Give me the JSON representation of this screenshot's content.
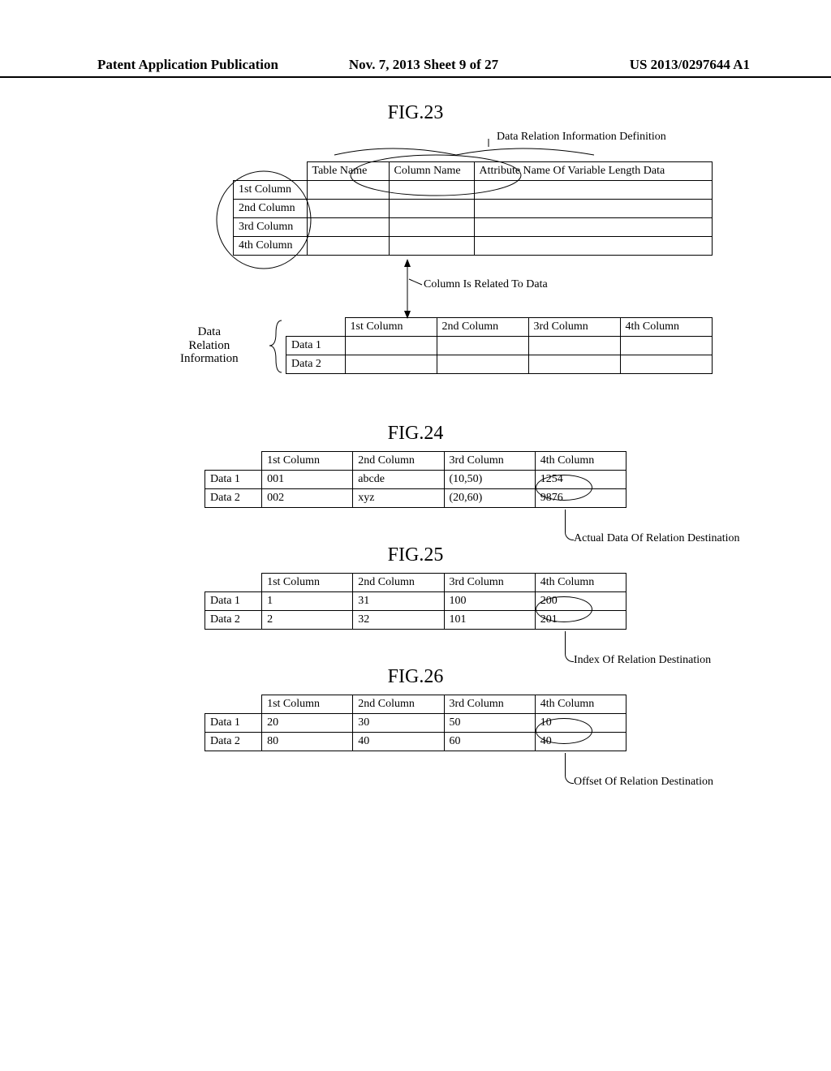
{
  "header": {
    "left": "Patent Application Publication",
    "mid": "Nov. 7, 2013  Sheet 9 of 27",
    "right": "US 2013/0297644 A1"
  },
  "fig23": {
    "label": "FIG.23",
    "def_label": "Data Relation Information Definition",
    "top_headers": {
      "th1": "Table Name",
      "th2": "Column Name",
      "th3": "Attribute Name Of Variable Length Data"
    },
    "rows": [
      "1st Column",
      "2nd Column",
      "3rd Column",
      "4th Column"
    ],
    "rel_msg": "Column Is Related To Data",
    "bot_headers": [
      "1st Column",
      "2nd Column",
      "3rd Column",
      "4th Column"
    ],
    "bot_rows": [
      "Data 1",
      "Data 2"
    ],
    "left_label_l1": "Data",
    "left_label_l2": "Relation",
    "left_label_l3": "Information"
  },
  "fig24": {
    "label": "FIG.24",
    "headers": [
      "1st Column",
      "2nd Column",
      "3rd Column",
      "4th Column"
    ],
    "rows": [
      {
        "name": "Data 1",
        "c1": "001",
        "c2": "abcde",
        "c3": "(10,50)",
        "c4": "1254"
      },
      {
        "name": "Data 2",
        "c1": "002",
        "c2": "xyz",
        "c3": "(20,60)",
        "c4": "9876"
      }
    ],
    "callout": "Actual Data Of Relation Destination"
  },
  "fig25": {
    "label": "FIG.25",
    "headers": [
      "1st Column",
      "2nd Column",
      "3rd Column",
      "4th Column"
    ],
    "rows": [
      {
        "name": "Data 1",
        "c1": "1",
        "c2": "31",
        "c3": "100",
        "c4": "200"
      },
      {
        "name": "Data 2",
        "c1": "2",
        "c2": "32",
        "c3": "101",
        "c4": "201"
      }
    ],
    "callout": "Index Of Relation Destination"
  },
  "fig26": {
    "label": "FIG.26",
    "headers": [
      "1st Column",
      "2nd Column",
      "3rd Column",
      "4th Column"
    ],
    "rows": [
      {
        "name": "Data 1",
        "c1": "20",
        "c2": "30",
        "c3": "50",
        "c4": "10"
      },
      {
        "name": "Data 2",
        "c1": "80",
        "c2": "40",
        "c3": "60",
        "c4": "40"
      }
    ],
    "callout": "Offset Of Relation Destination"
  }
}
